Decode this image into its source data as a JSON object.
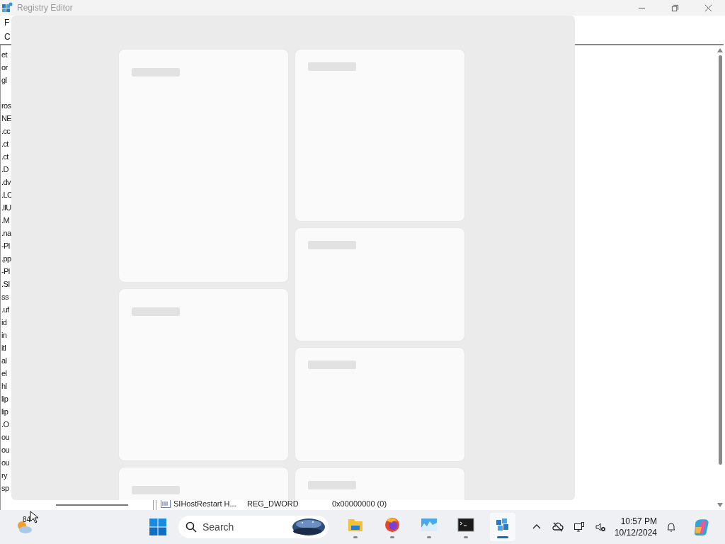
{
  "window": {
    "title": "Registry Editor",
    "menu_fragment": "F",
    "address_fragment": "C"
  },
  "tree_fragments": [
    "et",
    "or",
    "gl",
    "ros",
    "NE",
    ".cc",
    ".ct",
    ".ct",
    ".D",
    ".dv",
    ".LC",
    ".llU",
    ".M",
    ".na",
    "-Pl",
    ".pp",
    "-Pl",
    ".SI",
    "ss",
    ".uf",
    "id",
    "in",
    "itl",
    "al",
    "el",
    "hl",
    "lip",
    "lip",
    ".O",
    "ou",
    "ou",
    "ou",
    "ry",
    "sp"
  ],
  "value_row": {
    "name": "SIHostRestart H...",
    "type": "REG_DWORD",
    "data": "0x00000000 (0)"
  },
  "taskbar": {
    "weather_temp": "84",
    "search": {
      "placeholder": "Search"
    },
    "apps": [
      {
        "kind": "explorer",
        "selected": false
      },
      {
        "kind": "firefox",
        "selected": false
      },
      {
        "kind": "monitor",
        "selected": false
      },
      {
        "kind": "terminal",
        "selected": false
      },
      {
        "kind": "regedit",
        "selected": true
      }
    ],
    "time": "10:57 PM",
    "date": "10/12/2024"
  }
}
